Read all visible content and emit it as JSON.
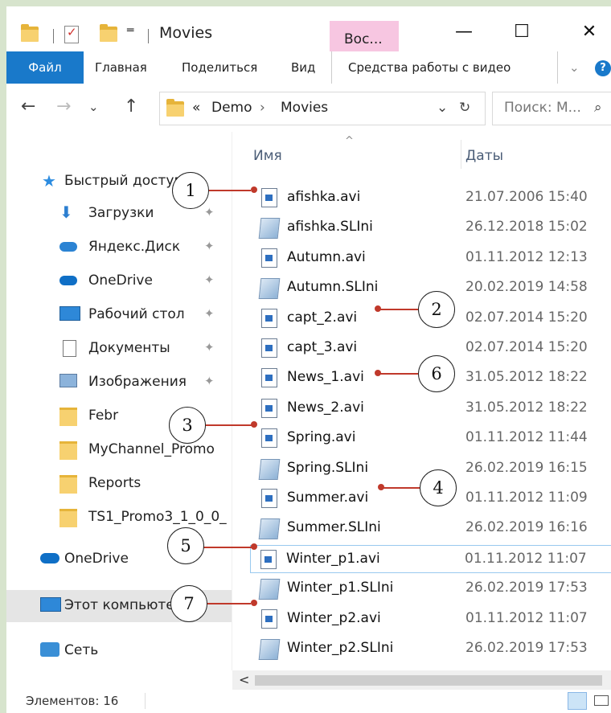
{
  "titlebar": {
    "title": "Movies",
    "context_tab": "Вос...",
    "minimize": "—",
    "maximize": "☐",
    "close": "✕"
  },
  "ribbon": {
    "file": "Файл",
    "home": "Главная",
    "share": "Поделиться",
    "view": "Вид",
    "video_tools": "Средства работы с видео",
    "expand": "⌄",
    "help": "?"
  },
  "nav": {
    "back": "←",
    "forward": "→",
    "recent": "⌄",
    "up": "↑",
    "crumb_overflow": "«",
    "crumb_1": "Demo",
    "crumb_sep": "›",
    "crumb_2": "Movies",
    "dropdown": "⌄",
    "refresh": "↻",
    "search_placeholder": "Поиск: М...",
    "search_icon": "⌕"
  },
  "sidebar": {
    "quick_access": "Быстрый доступ",
    "items": [
      {
        "label": "Загрузки",
        "icon": "download-icon",
        "pinned": true
      },
      {
        "label": "Яндекс.Диск",
        "icon": "cloud-icon",
        "pinned": true
      },
      {
        "label": "OneDrive",
        "icon": "onedrive-icon",
        "pinned": true
      },
      {
        "label": "Рабочий стол",
        "icon": "desktop-icon",
        "pinned": true
      },
      {
        "label": "Документы",
        "icon": "documents-icon",
        "pinned": true
      },
      {
        "label": "Изображения",
        "icon": "pictures-icon",
        "pinned": true
      },
      {
        "label": "Febr",
        "icon": "folder-icon",
        "pinned": false
      },
      {
        "label": "MyChannel_Promo",
        "icon": "folder-icon",
        "pinned": false
      },
      {
        "label": "Reports",
        "icon": "folder-icon",
        "pinned": false
      },
      {
        "label": "TS1_Promo3_1_0_0_",
        "icon": "folder-icon",
        "pinned": false
      }
    ],
    "onedrive": "OneDrive",
    "this_pc": "Этот компьютер",
    "network": "Сеть",
    "pin_glyph": "📌"
  },
  "columns": {
    "name": "Имя",
    "date": "Даты",
    "sort_glyph": "^"
  },
  "files": [
    {
      "name": "afishka.avi",
      "date": "21.07.2006 15:40",
      "type": "avi"
    },
    {
      "name": "afishka.SLIni",
      "date": "26.12.2018 15:02",
      "type": "slini"
    },
    {
      "name": "Autumn.avi",
      "date": "01.11.2012 12:13",
      "type": "avi"
    },
    {
      "name": "Autumn.SLIni",
      "date": "20.02.2019 14:58",
      "type": "slini"
    },
    {
      "name": "capt_2.avi",
      "date": "02.07.2014 15:20",
      "type": "avi"
    },
    {
      "name": "capt_3.avi",
      "date": "02.07.2014 15:20",
      "type": "avi"
    },
    {
      "name": "News_1.avi",
      "date": "31.05.2012 18:22",
      "type": "avi"
    },
    {
      "name": "News_2.avi",
      "date": "31.05.2012 18:22",
      "type": "avi"
    },
    {
      "name": "Spring.avi",
      "date": "01.11.2012 11:44",
      "type": "avi"
    },
    {
      "name": "Spring.SLIni",
      "date": "26.02.2019 16:15",
      "type": "slini"
    },
    {
      "name": "Summer.avi",
      "date": "01.11.2012 11:09",
      "type": "avi"
    },
    {
      "name": "Summer.SLIni",
      "date": "26.02.2019 16:16",
      "type": "slini"
    },
    {
      "name": "Winter_p1.avi",
      "date": "01.11.2012 11:07",
      "type": "avi",
      "selected": true
    },
    {
      "name": "Winter_p1.SLIni",
      "date": "26.02.2019 17:53",
      "type": "slini"
    },
    {
      "name": "Winter_p2.avi",
      "date": "01.11.2012 11:07",
      "type": "avi"
    },
    {
      "name": "Winter_p2.SLIni",
      "date": "26.02.2019 17:53",
      "type": "slini"
    }
  ],
  "scroll": {
    "left": "<",
    "right": ">"
  },
  "status": {
    "count": "Элементов: 16"
  },
  "callouts": [
    "1",
    "2",
    "3",
    "4",
    "5",
    "6",
    "7"
  ],
  "colors": {
    "accent": "#1979ca",
    "callout_line": "#c0392b",
    "context_tab": "#f7c6e1",
    "frame": "#d7e4cd"
  }
}
